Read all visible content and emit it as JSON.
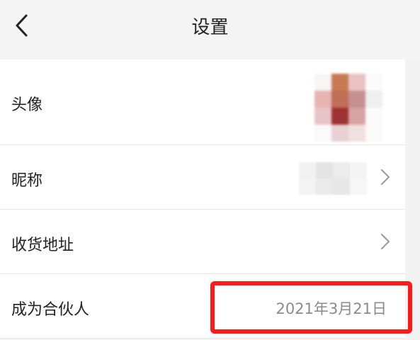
{
  "header": {
    "title": "设置",
    "back_icon": "chevron-left-icon"
  },
  "rows": [
    {
      "label": "头像",
      "value_type": "avatar"
    },
    {
      "label": "昵称",
      "value_type": "nickname",
      "has_chevron": true
    },
    {
      "label": "收货地址",
      "has_chevron": true
    },
    {
      "label": "成为合伙人",
      "value": "2021年3月21日"
    }
  ],
  "colors": {
    "highlight_border": "#ff1a1a",
    "value_text": "#8a8a8a",
    "background": "#f2f2f2"
  }
}
